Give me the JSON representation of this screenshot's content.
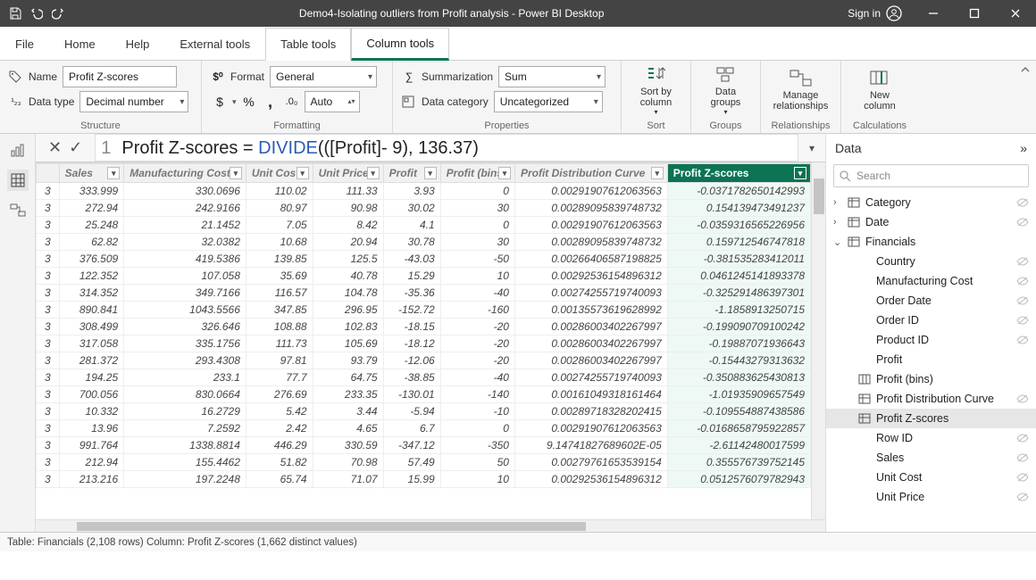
{
  "titlebar": {
    "title": "Demo4-Isolating outliers from Profit analysis - Power BI Desktop",
    "signin": "Sign in"
  },
  "menu": {
    "file": "File",
    "home": "Home",
    "help": "Help",
    "external": "External tools",
    "table": "Table tools",
    "column": "Column tools"
  },
  "ribbon": {
    "name_lab": "Name",
    "name_val": "Profit Z-scores",
    "dtype_lab": "Data type",
    "dtype_val": "Decimal number",
    "format_lab": "Format",
    "format_val": "General",
    "auto_val": "Auto",
    "summ_lab": "Summarization",
    "summ_val": "Sum",
    "cat_lab": "Data category",
    "cat_val": "Uncategorized",
    "sort_by": "Sort by\ncolumn",
    "data_groups": "Data\ngroups",
    "manage_rel": "Manage\nrelationships",
    "new_col": "New\ncolumn",
    "g_structure": "Structure",
    "g_formatting": "Formatting",
    "g_properties": "Properties",
    "g_sort": "Sort",
    "g_groups": "Groups",
    "g_rel": "Relationships",
    "g_calc": "Calculations"
  },
  "formula": {
    "line": "1",
    "prefix": "Profit Z-scores = ",
    "fn": "DIVIDE",
    "rest": "(([Profit]- 9), 136.37)"
  },
  "columns": [
    "Sales",
    "Manufacturing Cost",
    "Unit Cost",
    "Unit Price",
    "Profit",
    "Profit (bins)",
    "Profit Distribution Curve",
    "Profit Z-scores"
  ],
  "rows": [
    {
      "lead": "3",
      "c": [
        "333.999",
        "330.0696",
        "110.02",
        "111.33",
        "3.93",
        "0",
        "0.00291907612063563",
        "-0.0371782650142993"
      ]
    },
    {
      "lead": "3",
      "c": [
        "272.94",
        "242.9166",
        "80.97",
        "90.98",
        "30.02",
        "30",
        "0.00289095839748732",
        "0.154139473491237"
      ]
    },
    {
      "lead": "3",
      "c": [
        "25.248",
        "21.1452",
        "7.05",
        "8.42",
        "4.1",
        "0",
        "0.00291907612063563",
        "-0.0359316565226956"
      ]
    },
    {
      "lead": "3",
      "c": [
        "62.82",
        "32.0382",
        "10.68",
        "20.94",
        "30.78",
        "30",
        "0.00289095839748732",
        "0.159712546747818"
      ]
    },
    {
      "lead": "3",
      "c": [
        "376.509",
        "419.5386",
        "139.85",
        "125.5",
        "-43.03",
        "-50",
        "0.00266406587198825",
        "-0.381535283412011"
      ]
    },
    {
      "lead": "3",
      "c": [
        "122.352",
        "107.058",
        "35.69",
        "40.78",
        "15.29",
        "10",
        "0.00292536154896312",
        "0.0461245141893378"
      ]
    },
    {
      "lead": "3",
      "c": [
        "314.352",
        "349.7166",
        "116.57",
        "104.78",
        "-35.36",
        "-40",
        "0.00274255719740093",
        "-0.325291486397301"
      ]
    },
    {
      "lead": "3",
      "c": [
        "890.841",
        "1043.5566",
        "347.85",
        "296.95",
        "-152.72",
        "-160",
        "0.00135573619628992",
        "-1.1858913250715"
      ]
    },
    {
      "lead": "3",
      "c": [
        "308.499",
        "326.646",
        "108.88",
        "102.83",
        "-18.15",
        "-20",
        "0.00286003402267997",
        "-0.199090709100242"
      ]
    },
    {
      "lead": "3",
      "c": [
        "317.058",
        "335.1756",
        "111.73",
        "105.69",
        "-18.12",
        "-20",
        "0.00286003402267997",
        "-0.19887071936643"
      ]
    },
    {
      "lead": "3",
      "c": [
        "281.372",
        "293.4308",
        "97.81",
        "93.79",
        "-12.06",
        "-20",
        "0.00286003402267997",
        "-0.15443279313632"
      ]
    },
    {
      "lead": "3",
      "c": [
        "194.25",
        "233.1",
        "77.7",
        "64.75",
        "-38.85",
        "-40",
        "0.00274255719740093",
        "-0.350883625430813"
      ]
    },
    {
      "lead": "3",
      "c": [
        "700.056",
        "830.0664",
        "276.69",
        "233.35",
        "-130.01",
        "-140",
        "0.00161049318161464",
        "-1.01935909657549"
      ]
    },
    {
      "lead": "3",
      "c": [
        "10.332",
        "16.2729",
        "5.42",
        "3.44",
        "-5.94",
        "-10",
        "0.00289718328202415",
        "-0.109554887438586"
      ]
    },
    {
      "lead": "3",
      "c": [
        "13.96",
        "7.2592",
        "2.42",
        "4.65",
        "6.7",
        "0",
        "0.00291907612063563",
        "-0.0168658795922857"
      ]
    },
    {
      "lead": "3",
      "c": [
        "991.764",
        "1338.8814",
        "446.29",
        "330.59",
        "-347.12",
        "-350",
        "9.14741827689602E-05",
        "-2.61142480017599"
      ]
    },
    {
      "lead": "3",
      "c": [
        "212.94",
        "155.4462",
        "51.82",
        "70.98",
        "57.49",
        "50",
        "0.00279761653539154",
        "0.355576739752145"
      ]
    },
    {
      "lead": "3",
      "c": [
        "213.216",
        "197.2248",
        "65.74",
        "71.07",
        "15.99",
        "10",
        "0.00292536154896312",
        "0.0512576079782943"
      ]
    }
  ],
  "fields": {
    "title": "Data",
    "search": "Search",
    "tables": [
      {
        "name": "Category",
        "open": false
      },
      {
        "name": "Date",
        "open": false
      },
      {
        "name": "Financials",
        "open": true,
        "children": [
          {
            "name": "Country",
            "hidden": true
          },
          {
            "name": "Manufacturing Cost",
            "hidden": true
          },
          {
            "name": "Order Date",
            "hidden": true
          },
          {
            "name": "Order ID",
            "hidden": true
          },
          {
            "name": "Product ID",
            "hidden": true
          },
          {
            "name": "Profit",
            "hidden": false
          },
          {
            "name": "Profit (bins)",
            "hidden": false,
            "icon": "bins"
          },
          {
            "name": "Profit Distribution Curve",
            "hidden": true,
            "icon": "measure"
          },
          {
            "name": "Profit Z-scores",
            "hidden": false,
            "icon": "measure",
            "selected": true
          },
          {
            "name": "Row ID",
            "hidden": true
          },
          {
            "name": "Sales",
            "hidden": true
          },
          {
            "name": "Unit Cost",
            "hidden": true
          },
          {
            "name": "Unit Price",
            "hidden": true
          }
        ]
      }
    ]
  },
  "status": "Table: Financials (2,108 rows) Column: Profit Z-scores (1,662 distinct values)"
}
